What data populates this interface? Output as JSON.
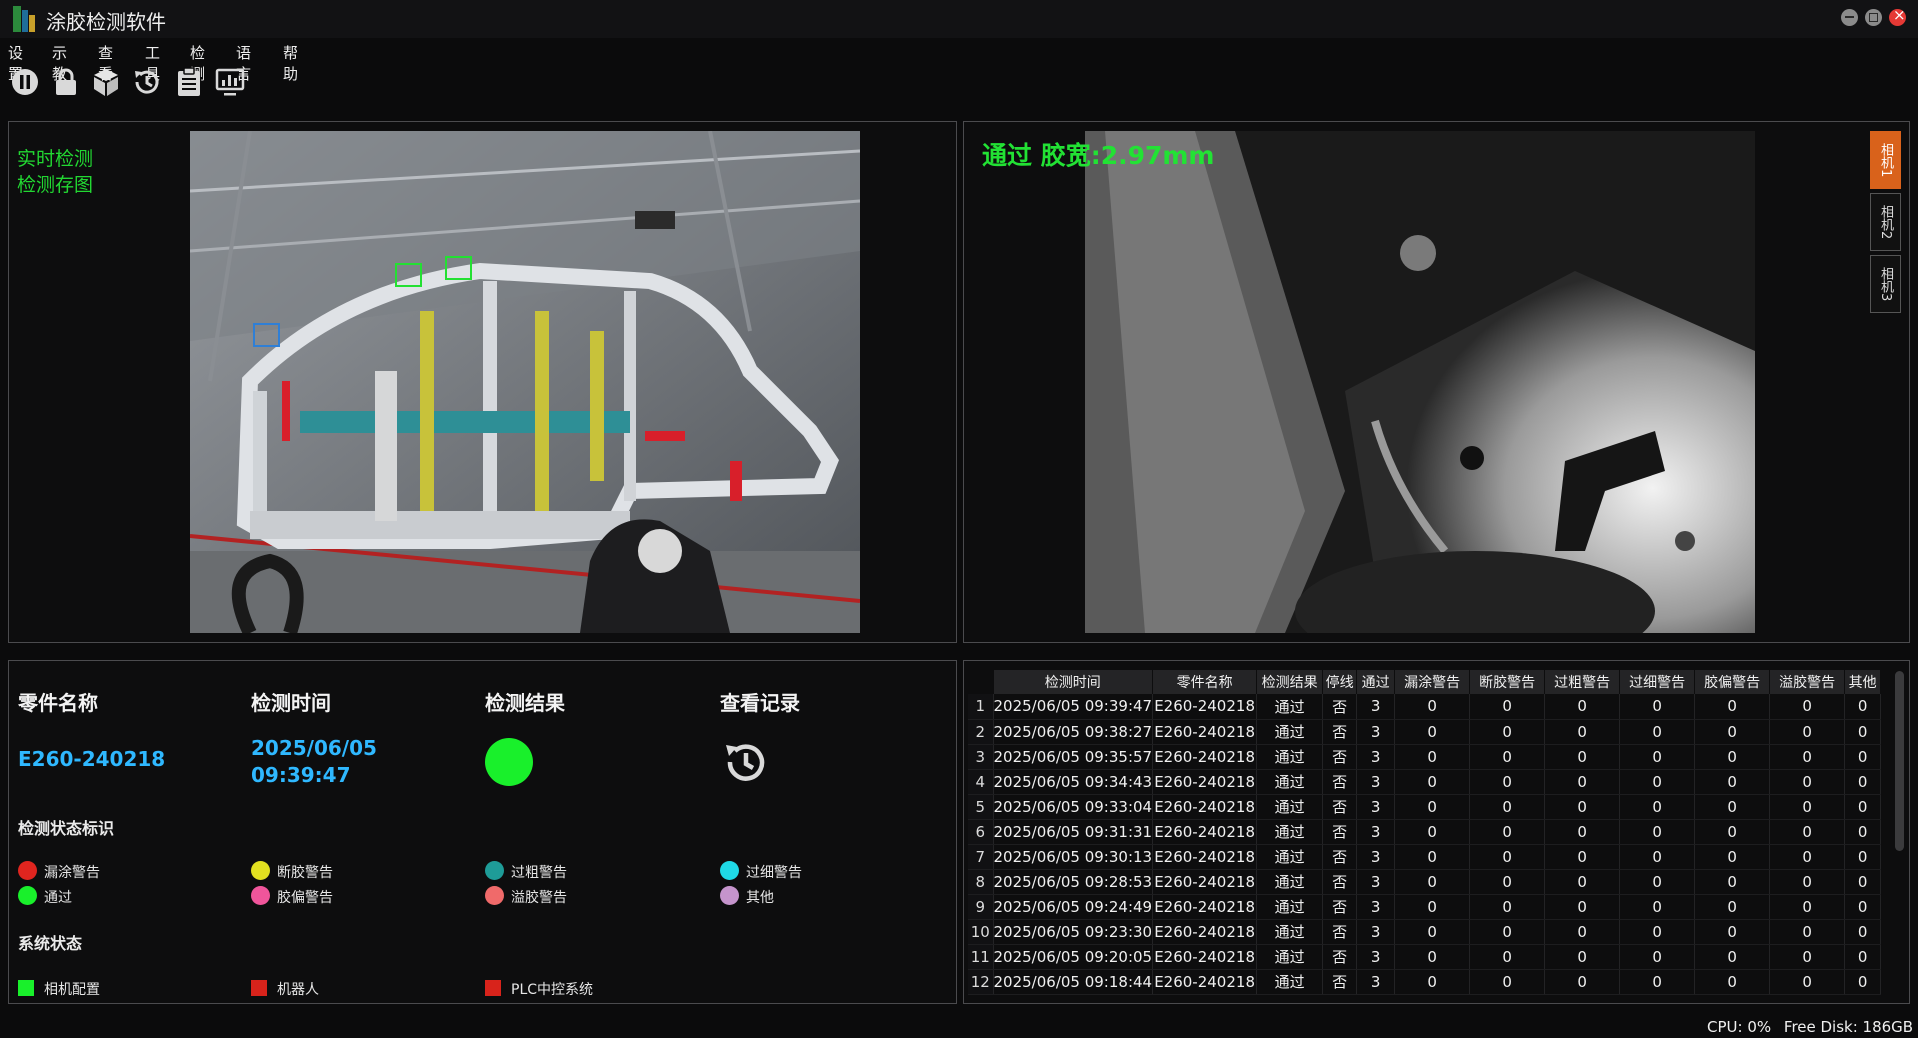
{
  "app": {
    "title": "涂胶检测软件"
  },
  "menu": [
    "设置",
    "示教",
    "查看",
    "工具",
    "检测",
    "语言",
    "帮助"
  ],
  "toolbar": [
    "pause-icon",
    "lock-icon",
    "cube-icon",
    "history-icon",
    "clipboard-icon",
    "monitor-chart-icon"
  ],
  "live_panel": {
    "links": [
      "实时检测",
      "检测存图"
    ]
  },
  "camera_panel": {
    "result_text": "通过 胶宽:2.97mm",
    "tabs": [
      "相机1",
      "相机2",
      "相机3"
    ],
    "active_tab": 0
  },
  "info_panel": {
    "headers": [
      "零件名称",
      "检测时间",
      "检测结果",
      "查看记录"
    ],
    "part_name": "E260-240218",
    "check_date": "2025/06/05",
    "check_time": "09:39:47",
    "result_color": "#19f02b",
    "legend_title": "检测状态标识",
    "legend": [
      {
        "label": "漏涂警告",
        "color": "#e0251f"
      },
      {
        "label": "断胶警告",
        "color": "#e2e020"
      },
      {
        "label": "过粗警告",
        "color": "#1e9c98"
      },
      {
        "label": "过细警告",
        "color": "#1fd9e6"
      },
      {
        "label": "通过",
        "color": "#19f02b"
      },
      {
        "label": "胶偏警告",
        "color": "#f0559b"
      },
      {
        "label": "溢胶警告",
        "color": "#f06a6a"
      },
      {
        "label": "其他",
        "color": "#c594cc"
      }
    ],
    "system_title": "系统状态",
    "system": [
      {
        "label": "相机配置",
        "color": "#19f02b"
      },
      {
        "label": "机器人",
        "color": "#d8231b"
      },
      {
        "label": "PLC中控系统",
        "color": "#d8231b"
      }
    ]
  },
  "table": {
    "columns": [
      "检测时间",
      "零件名称",
      "检测结果",
      "停线",
      "通过",
      "漏涂警告",
      "断胶警告",
      "过粗警告",
      "过细警告",
      "胶偏警告",
      "溢胶警告",
      "其他"
    ],
    "rows": [
      [
        "1",
        "2025/06/05 09:39:47",
        "E260-240218",
        "通过",
        "否",
        "3",
        "0",
        "0",
        "0",
        "0",
        "0",
        "0",
        "0"
      ],
      [
        "2",
        "2025/06/05 09:38:27",
        "E260-240218",
        "通过",
        "否",
        "3",
        "0",
        "0",
        "0",
        "0",
        "0",
        "0",
        "0"
      ],
      [
        "3",
        "2025/06/05 09:35:57",
        "E260-240218",
        "通过",
        "否",
        "3",
        "0",
        "0",
        "0",
        "0",
        "0",
        "0",
        "0"
      ],
      [
        "4",
        "2025/06/05 09:34:43",
        "E260-240218",
        "通过",
        "否",
        "3",
        "0",
        "0",
        "0",
        "0",
        "0",
        "0",
        "0"
      ],
      [
        "5",
        "2025/06/05 09:33:04",
        "E260-240218",
        "通过",
        "否",
        "3",
        "0",
        "0",
        "0",
        "0",
        "0",
        "0",
        "0"
      ],
      [
        "6",
        "2025/06/05 09:31:31",
        "E260-240218",
        "通过",
        "否",
        "3",
        "0",
        "0",
        "0",
        "0",
        "0",
        "0",
        "0"
      ],
      [
        "7",
        "2025/06/05 09:30:13",
        "E260-240218",
        "通过",
        "否",
        "3",
        "0",
        "0",
        "0",
        "0",
        "0",
        "0",
        "0"
      ],
      [
        "8",
        "2025/06/05 09:28:53",
        "E260-240218",
        "通过",
        "否",
        "3",
        "0",
        "0",
        "0",
        "0",
        "0",
        "0",
        "0"
      ],
      [
        "9",
        "2025/06/05 09:24:49",
        "E260-240218",
        "通过",
        "否",
        "3",
        "0",
        "0",
        "0",
        "0",
        "0",
        "0",
        "0"
      ],
      [
        "10",
        "2025/06/05 09:23:30",
        "E260-240218",
        "通过",
        "否",
        "3",
        "0",
        "0",
        "0",
        "0",
        "0",
        "0",
        "0"
      ],
      [
        "11",
        "2025/06/05 09:20:05",
        "E260-240218",
        "通过",
        "否",
        "3",
        "0",
        "0",
        "0",
        "0",
        "0",
        "0",
        "0"
      ],
      [
        "12",
        "2025/06/05 09:18:44",
        "E260-240218",
        "通过",
        "否",
        "3",
        "0",
        "0",
        "0",
        "0",
        "0",
        "0",
        "0"
      ]
    ]
  },
  "status_bar": {
    "cpu": "CPU: 0%",
    "disk": "Free Disk: 186GB"
  }
}
